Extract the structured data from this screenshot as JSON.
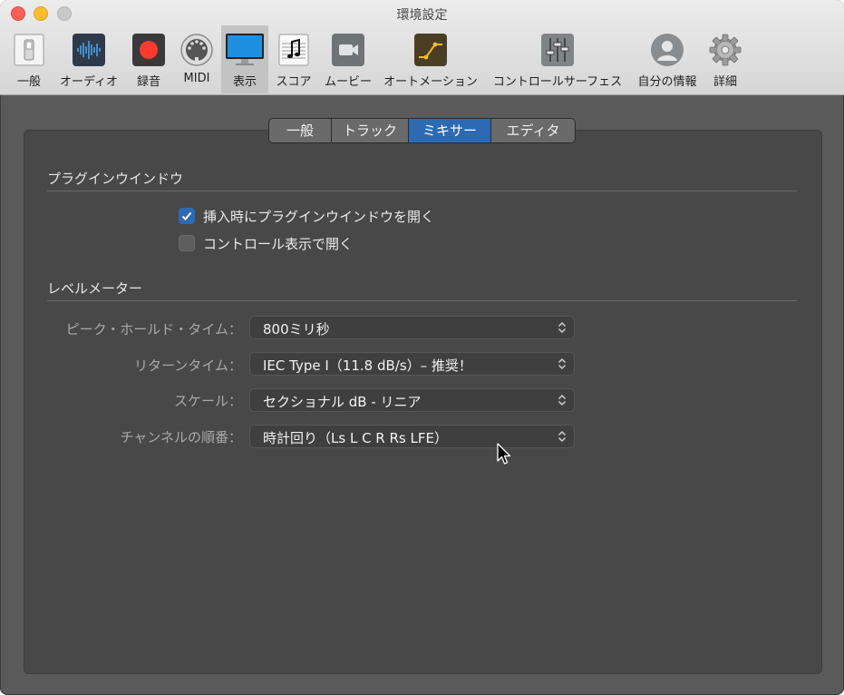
{
  "window": {
    "title": "環境設定"
  },
  "toolbar": {
    "items": [
      {
        "label": "一般",
        "icon": "general-switch-icon"
      },
      {
        "label": "オーディオ",
        "icon": "audio-waveform-icon"
      },
      {
        "label": "録音",
        "icon": "record-icon"
      },
      {
        "label": "MIDI",
        "icon": "midi-connector-icon"
      },
      {
        "label": "表示",
        "icon": "display-monitor-icon"
      },
      {
        "label": "スコア",
        "icon": "score-notes-icon"
      },
      {
        "label": "ムービー",
        "icon": "movie-camera-icon"
      },
      {
        "label": "オートメーション",
        "icon": "automation-curve-icon"
      },
      {
        "label": "コントロールサーフェス",
        "icon": "faders-icon"
      },
      {
        "label": "自分の情報",
        "icon": "user-avatar-icon"
      },
      {
        "label": "詳細",
        "icon": "gear-icon"
      }
    ],
    "selected": "表示"
  },
  "tabs": {
    "items": [
      "一般",
      "トラック",
      "ミキサー",
      "エディタ"
    ],
    "selected": "ミキサー"
  },
  "plugin_window": {
    "heading": "プラグインウインドウ",
    "options": [
      {
        "label": "挿入時にプラグインウインドウを開く",
        "checked": true
      },
      {
        "label": "コントロール表示で開く",
        "checked": false
      }
    ]
  },
  "level_meter": {
    "heading": "レベルメーター",
    "rows": [
      {
        "label": "ピーク・ホールド・タイム：",
        "value": "800ミリ秒"
      },
      {
        "label": "リターンタイム：",
        "value": "IEC Type I（11.8 dB/s）– 推奨！"
      },
      {
        "label": "スケール：",
        "value": "セクショナル dB - リニア"
      },
      {
        "label": "チャンネルの順番：",
        "value": "時計回り（Ls L C R Rs LFE）"
      }
    ]
  },
  "colors": {
    "accent": "#2c6bb3",
    "panel": "#484848",
    "background": "#5a5a5a"
  }
}
